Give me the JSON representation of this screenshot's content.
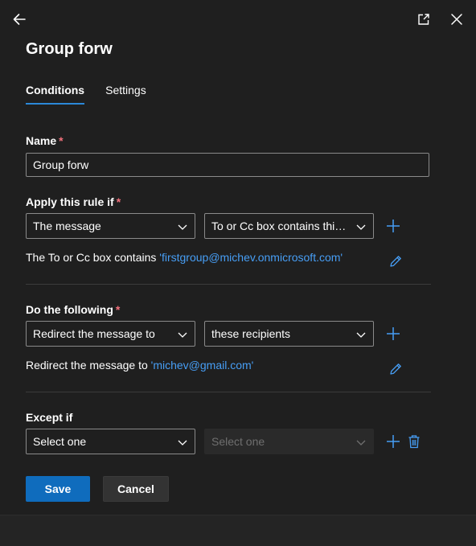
{
  "header": {
    "back_icon": "arrow-left-icon",
    "popout_icon": "open-in-new-window-icon",
    "close_icon": "close-icon",
    "title": "Group forw"
  },
  "tabs": [
    {
      "label": "Conditions",
      "active": true
    },
    {
      "label": "Settings",
      "active": false
    }
  ],
  "name_section": {
    "label": "Name",
    "required_mark": "*",
    "value": "Group forw"
  },
  "apply_section": {
    "label": "Apply this rule if",
    "required_mark": "*",
    "condition_dropdown": "The message",
    "predicate_dropdown": "To or Cc box contains this ...",
    "summary_prefix": "The To or Cc box contains ",
    "summary_value": "'firstgroup@michev.onmicrosoft.com'"
  },
  "do_section": {
    "label": "Do the following",
    "required_mark": "*",
    "action_dropdown": "Redirect the message to",
    "target_dropdown": "these recipients",
    "summary_prefix": "Redirect the message to ",
    "summary_value": "'michev@gmail.com'"
  },
  "except_section": {
    "label": "Except if",
    "first_dropdown": "Select one",
    "second_dropdown": "Select one"
  },
  "footer": {
    "save_label": "Save",
    "cancel_label": "Cancel"
  },
  "colors": {
    "accent": "#0f6cbd",
    "link": "#479ef5",
    "required": "#f1707b",
    "background": "#1f1f1f"
  }
}
